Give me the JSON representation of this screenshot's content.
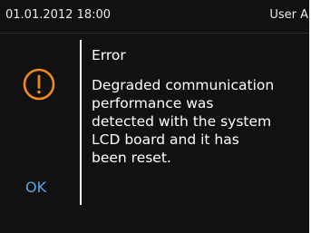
{
  "status_bar": {
    "datetime": "01.01.2012 18:00",
    "user": "User A"
  },
  "dialog": {
    "icon": "warning-icon",
    "title": "Error",
    "message": "Degraded communication\nperformance was\ndetected with the system\nLCD board and it has\nbeen reset.",
    "ok_label": "OK"
  },
  "colors": {
    "background": "#111111",
    "icon": "#f08a1c",
    "ok": "#5aa6e6",
    "text": "#ffffff"
  }
}
